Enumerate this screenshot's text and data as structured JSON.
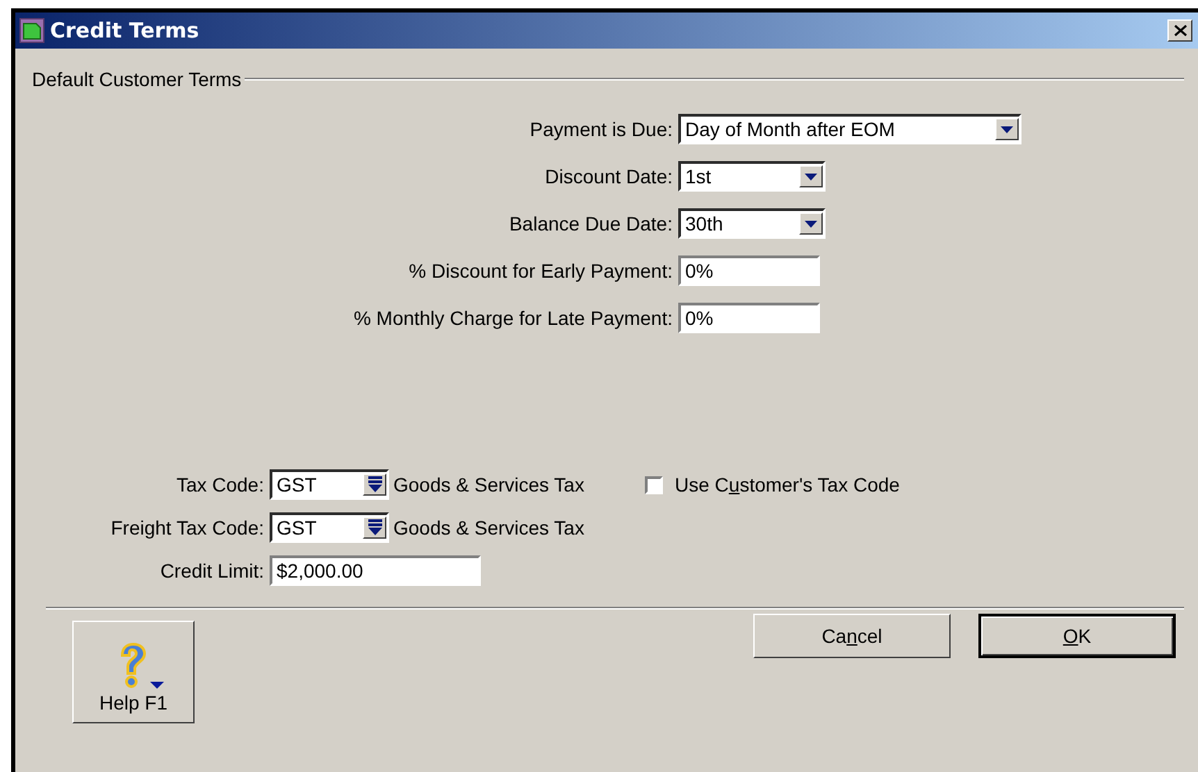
{
  "window": {
    "title": "Credit Terms"
  },
  "group": {
    "title": "Default Customer Terms"
  },
  "terms": [
    {
      "kind": "dropdown",
      "label": "Payment is Due:",
      "value": "Day of Month after EOM"
    },
    {
      "kind": "dropdown",
      "label": "Discount Date:",
      "value": "1st"
    },
    {
      "kind": "dropdown",
      "label": "Balance Due Date:",
      "value": "30th"
    },
    {
      "kind": "text",
      "label": "% Discount for Early Payment:",
      "value": "0%"
    },
    {
      "kind": "text",
      "label": "% Monthly Charge for Late Payment:",
      "value": "0%"
    }
  ],
  "tax_rows": [
    {
      "kind": "code",
      "label": "Tax Code:",
      "value": "GST",
      "description": "Goods & Services Tax"
    },
    {
      "kind": "code",
      "label": "Freight Tax Code:",
      "value": "GST",
      "description": "Goods & Services Tax"
    },
    {
      "kind": "text",
      "label": "Credit Limit:",
      "value": "$2,000.00"
    }
  ],
  "use_customer_tax_code": {
    "before": "Use C",
    "key": "u",
    "after": "stomer's Tax Code",
    "checked": false
  },
  "help_button": {
    "label": "Help F1"
  },
  "buttons": [
    {
      "before": "Ca",
      "key": "n",
      "after": "cel",
      "default": false
    },
    {
      "key": "O",
      "after": "K",
      "default": true
    }
  ]
}
